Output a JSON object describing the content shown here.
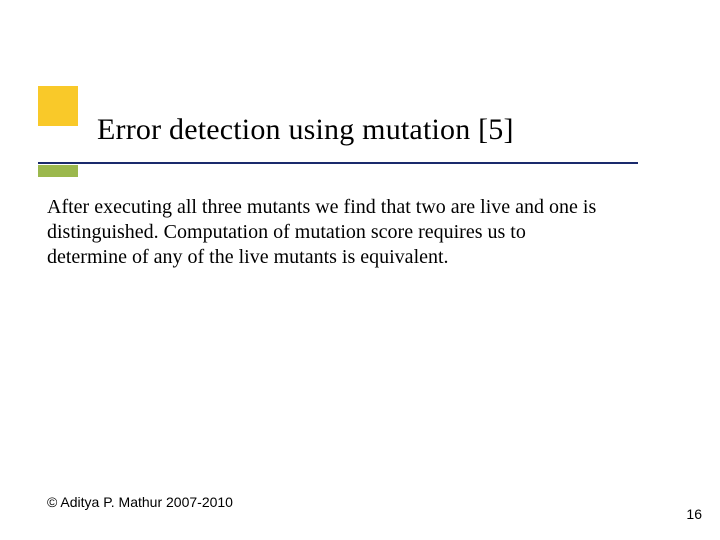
{
  "slide": {
    "title": "Error detection using mutation [5]",
    "body": "After executing all three mutants we find that two are live and one is distinguished. Computation of mutation score requires us to determine of any of the live mutants is equivalent.",
    "footer": "© Aditya P. Mathur 2007-2010",
    "page_number": "16"
  }
}
